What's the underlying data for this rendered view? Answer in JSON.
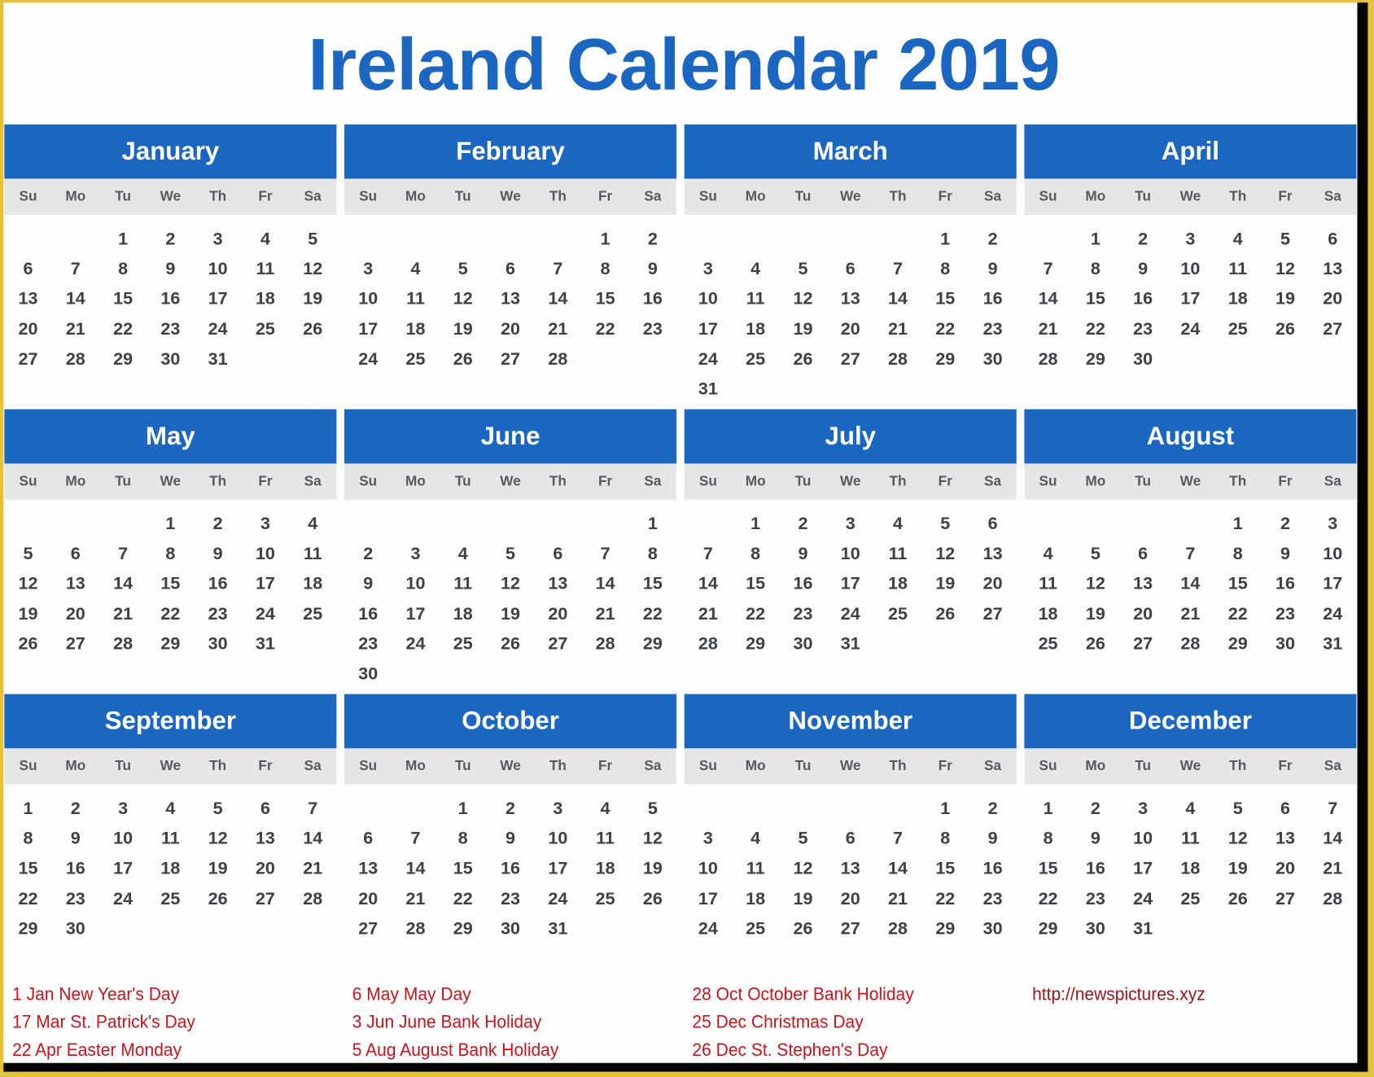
{
  "title": "Ireland Calendar 2019",
  "weekdays": [
    "Su",
    "Mo",
    "Tu",
    "We",
    "Th",
    "Fr",
    "Sa"
  ],
  "colors": {
    "accent": "#1b66c0",
    "weekday_band": "#e6e6e6",
    "holiday_text": "#c8151b",
    "day_text": "#3d4045"
  },
  "months": [
    {
      "name": "January",
      "weeks": [
        [
          "",
          "",
          "1",
          "2",
          "3",
          "4",
          "5"
        ],
        [
          "6",
          "7",
          "8",
          "9",
          "10",
          "11",
          "12"
        ],
        [
          "13",
          "14",
          "15",
          "16",
          "17",
          "18",
          "19"
        ],
        [
          "20",
          "21",
          "22",
          "23",
          "24",
          "25",
          "26"
        ],
        [
          "27",
          "28",
          "29",
          "30",
          "31",
          "",
          ""
        ]
      ]
    },
    {
      "name": "February",
      "weeks": [
        [
          "",
          "",
          "",
          "",
          "",
          "1",
          "2"
        ],
        [
          "3",
          "4",
          "5",
          "6",
          "7",
          "8",
          "9"
        ],
        [
          "10",
          "11",
          "12",
          "13",
          "14",
          "15",
          "16"
        ],
        [
          "17",
          "18",
          "19",
          "20",
          "21",
          "22",
          "23"
        ],
        [
          "24",
          "25",
          "26",
          "27",
          "28",
          "",
          ""
        ]
      ]
    },
    {
      "name": "March",
      "weeks": [
        [
          "",
          "",
          "",
          "",
          "",
          "1",
          "2"
        ],
        [
          "3",
          "4",
          "5",
          "6",
          "7",
          "8",
          "9"
        ],
        [
          "10",
          "11",
          "12",
          "13",
          "14",
          "15",
          "16"
        ],
        [
          "17",
          "18",
          "19",
          "20",
          "21",
          "22",
          "23"
        ],
        [
          "24",
          "25",
          "26",
          "27",
          "28",
          "29",
          "30"
        ],
        [
          "31",
          "",
          "",
          "",
          "",
          "",
          ""
        ]
      ]
    },
    {
      "name": "April",
      "weeks": [
        [
          "",
          "1",
          "2",
          "3",
          "4",
          "5",
          "6"
        ],
        [
          "7",
          "8",
          "9",
          "10",
          "11",
          "12",
          "13"
        ],
        [
          "14",
          "15",
          "16",
          "17",
          "18",
          "19",
          "20"
        ],
        [
          "21",
          "22",
          "23",
          "24",
          "25",
          "26",
          "27"
        ],
        [
          "28",
          "29",
          "30",
          "",
          "",
          "",
          ""
        ]
      ]
    },
    {
      "name": "May",
      "weeks": [
        [
          "",
          "",
          "",
          "1",
          "2",
          "3",
          "4"
        ],
        [
          "5",
          "6",
          "7",
          "8",
          "9",
          "10",
          "11"
        ],
        [
          "12",
          "13",
          "14",
          "15",
          "16",
          "17",
          "18"
        ],
        [
          "19",
          "20",
          "21",
          "22",
          "23",
          "24",
          "25"
        ],
        [
          "26",
          "27",
          "28",
          "29",
          "30",
          "31",
          ""
        ]
      ]
    },
    {
      "name": "June",
      "weeks": [
        [
          "",
          "",
          "",
          "",
          "",
          "",
          "1"
        ],
        [
          "2",
          "3",
          "4",
          "5",
          "6",
          "7",
          "8"
        ],
        [
          "9",
          "10",
          "11",
          "12",
          "13",
          "14",
          "15"
        ],
        [
          "16",
          "17",
          "18",
          "19",
          "20",
          "21",
          "22"
        ],
        [
          "23",
          "24",
          "25",
          "26",
          "27",
          "28",
          "29"
        ],
        [
          "30",
          "",
          "",
          "",
          "",
          "",
          ""
        ]
      ]
    },
    {
      "name": "July",
      "weeks": [
        [
          "",
          "1",
          "2",
          "3",
          "4",
          "5",
          "6"
        ],
        [
          "7",
          "8",
          "9",
          "10",
          "11",
          "12",
          "13"
        ],
        [
          "14",
          "15",
          "16",
          "17",
          "18",
          "19",
          "20"
        ],
        [
          "21",
          "22",
          "23",
          "24",
          "25",
          "26",
          "27"
        ],
        [
          "28",
          "29",
          "30",
          "31",
          "",
          "",
          ""
        ]
      ]
    },
    {
      "name": "August",
      "weeks": [
        [
          "",
          "",
          "",
          "",
          "1",
          "2",
          "3"
        ],
        [
          "4",
          "5",
          "6",
          "7",
          "8",
          "9",
          "10"
        ],
        [
          "11",
          "12",
          "13",
          "14",
          "15",
          "16",
          "17"
        ],
        [
          "18",
          "19",
          "20",
          "21",
          "22",
          "23",
          "24"
        ],
        [
          "25",
          "26",
          "27",
          "28",
          "29",
          "30",
          "31"
        ]
      ]
    },
    {
      "name": "September",
      "weeks": [
        [
          "1",
          "2",
          "3",
          "4",
          "5",
          "6",
          "7"
        ],
        [
          "8",
          "9",
          "10",
          "11",
          "12",
          "13",
          "14"
        ],
        [
          "15",
          "16",
          "17",
          "18",
          "19",
          "20",
          "21"
        ],
        [
          "22",
          "23",
          "24",
          "25",
          "26",
          "27",
          "28"
        ],
        [
          "29",
          "30",
          "",
          "",
          "",
          "",
          ""
        ]
      ]
    },
    {
      "name": "October",
      "weeks": [
        [
          "",
          "",
          "1",
          "2",
          "3",
          "4",
          "5"
        ],
        [
          "6",
          "7",
          "8",
          "9",
          "10",
          "11",
          "12"
        ],
        [
          "13",
          "14",
          "15",
          "16",
          "17",
          "18",
          "19"
        ],
        [
          "20",
          "21",
          "22",
          "23",
          "24",
          "25",
          "26"
        ],
        [
          "27",
          "28",
          "29",
          "30",
          "31",
          "",
          ""
        ]
      ]
    },
    {
      "name": "November",
      "weeks": [
        [
          "",
          "",
          "",
          "",
          "",
          "1",
          "2"
        ],
        [
          "3",
          "4",
          "5",
          "6",
          "7",
          "8",
          "9"
        ],
        [
          "10",
          "11",
          "12",
          "13",
          "14",
          "15",
          "16"
        ],
        [
          "17",
          "18",
          "19",
          "20",
          "21",
          "22",
          "23"
        ],
        [
          "24",
          "25",
          "26",
          "27",
          "28",
          "29",
          "30"
        ]
      ]
    },
    {
      "name": "December",
      "weeks": [
        [
          "1",
          "2",
          "3",
          "4",
          "5",
          "6",
          "7"
        ],
        [
          "8",
          "9",
          "10",
          "11",
          "12",
          "13",
          "14"
        ],
        [
          "15",
          "16",
          "17",
          "18",
          "19",
          "20",
          "21"
        ],
        [
          "22",
          "23",
          "24",
          "25",
          "26",
          "27",
          "28"
        ],
        [
          "29",
          "30",
          "31",
          "",
          "",
          "",
          ""
        ]
      ]
    }
  ],
  "holidays": [
    [
      "1 Jan New Year's Day",
      "17 Mar St. Patrick's Day",
      "22 Apr Easter Monday"
    ],
    [
      "6 May May Day",
      "3 Jun June Bank Holiday",
      "5 Aug August Bank Holiday"
    ],
    [
      "28 Oct October Bank Holiday",
      "25 Dec Christmas Day",
      "26 Dec St. Stephen's Day"
    ]
  ],
  "source_link": "http://newspictures.xyz"
}
